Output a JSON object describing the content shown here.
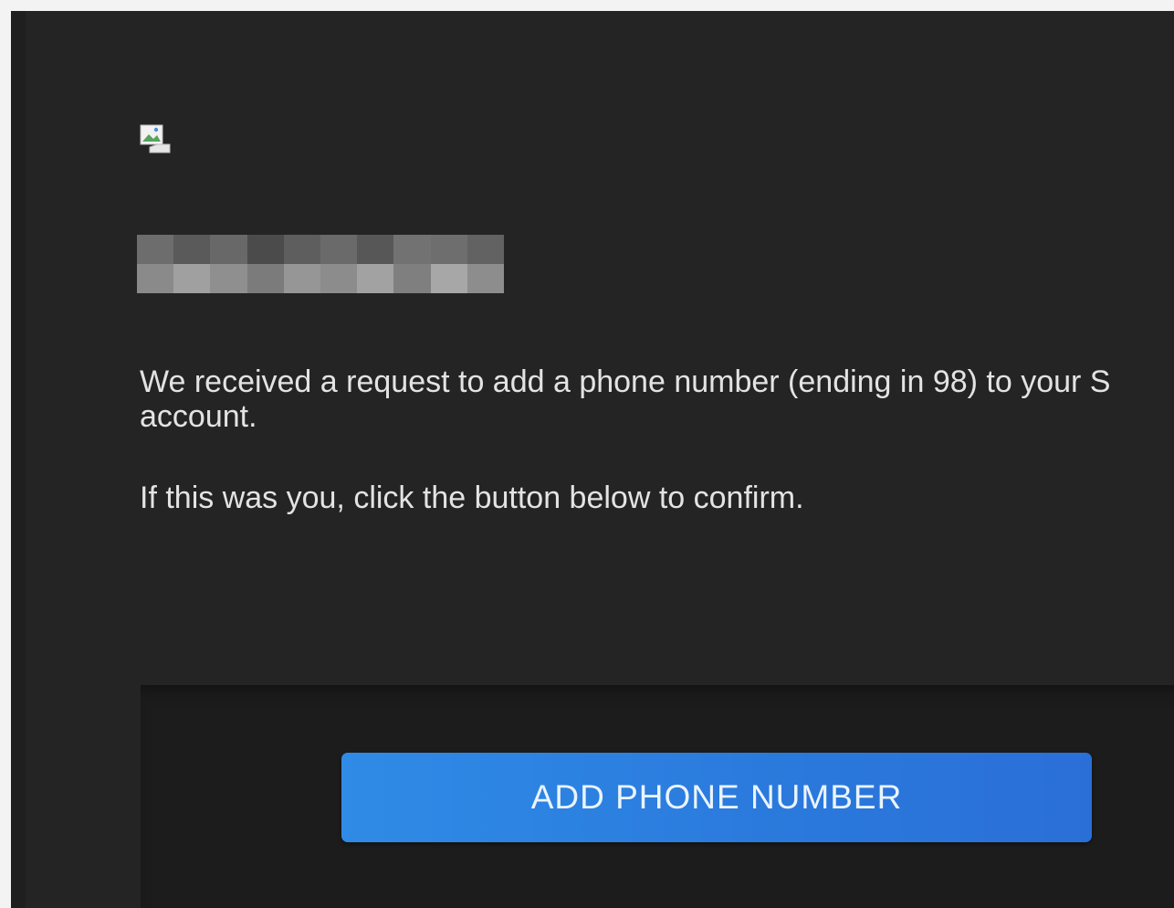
{
  "email": {
    "logo": {
      "icon": "broken-image-icon"
    },
    "recipient_name": {
      "redacted": true
    },
    "message": {
      "line1": "We received a request to add a phone number (ending in 98) to your S",
      "line2": "account.",
      "confirm": "If this was you, click the button below to confirm."
    },
    "cta": {
      "label": "ADD PHONE NUMBER"
    }
  },
  "colors": {
    "background": "#242424",
    "text": "#e3e3e3",
    "button": "#2a79dc",
    "button_text": "#eaf4ff"
  }
}
